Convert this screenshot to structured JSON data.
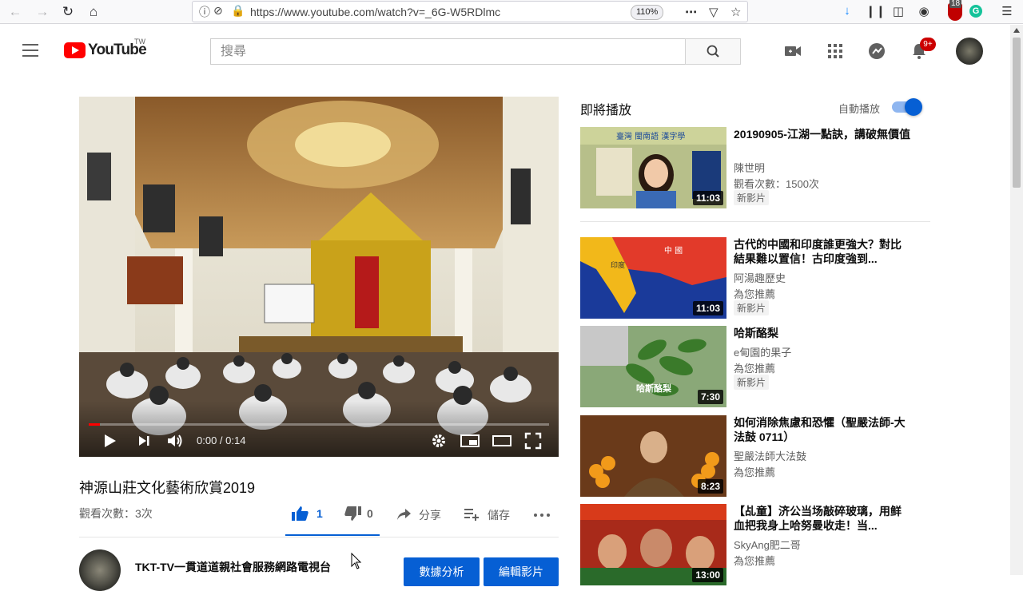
{
  "browser": {
    "url": "https://www.youtube.com/watch?v=_6G-W5RDlmc",
    "zoom": "110%",
    "addon_badge_count": "18",
    "grammarly_letter": "G"
  },
  "header": {
    "logo_text": "YouTube",
    "country_code": "TW",
    "search_placeholder": "搜尋",
    "notification_count": "9+"
  },
  "video": {
    "current_time": "0:00 / 0:14",
    "progress_fraction": 0.0,
    "title": "神源山莊文化藝術欣賞2019",
    "views": "觀看次數：3次",
    "likes": "1",
    "dislikes": "0",
    "share_label": "分享",
    "save_label": "儲存"
  },
  "channel": {
    "name": "TKT-TV一貫道道親社會服務網路電視台",
    "analytics_button": "數據分析",
    "edit_button": "編輯影片"
  },
  "sidebar": {
    "up_next_label": "即將播放",
    "autoplay_label": "自動播放",
    "autoplay_on": true,
    "items": [
      {
        "title": "20190905-江湖一點訣，講破無價值",
        "channel": "陳世明",
        "meta": "觀看次數：1500次",
        "badge": "新影片",
        "duration": "11:03"
      },
      {
        "title": "古代的中國和印度誰更強大？對比結果難以置信！古印度強到...",
        "channel": "阿湯趣歷史",
        "meta": "為您推薦",
        "badge": "新影片",
        "duration": "11:03"
      },
      {
        "title": "哈斯酪梨",
        "channel": "e甸園的果子",
        "meta": "為您推薦",
        "badge": "新影片",
        "duration": "7:30"
      },
      {
        "title": "如何消除焦慮和恐懼（聖嚴法師-大法鼓 0711）",
        "channel": "聖嚴法師大法鼓",
        "meta": "為您推薦",
        "badge": "",
        "duration": "8:23"
      },
      {
        "title": "【乩童】济公当场敲碎玻璃，用鲜血把我身上哈努曼收走！当...",
        "channel": "SkyAng肥二哥",
        "meta": "為您推薦",
        "badge": "",
        "duration": "13:00"
      }
    ]
  }
}
